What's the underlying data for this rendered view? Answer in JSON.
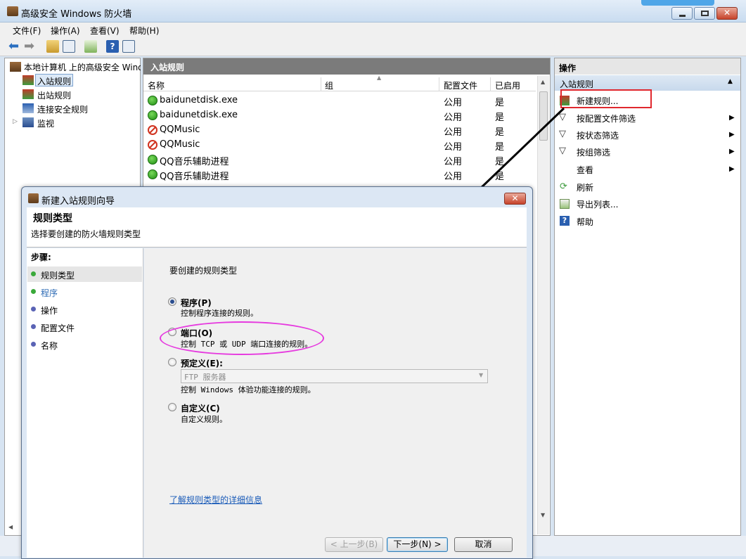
{
  "window": {
    "title": "高级安全 Windows 防火墙"
  },
  "menu": [
    "文件(F)",
    "操作(A)",
    "查看(V)",
    "帮助(H)"
  ],
  "tree": {
    "root": "本地计算机 上的高级安全 Wind",
    "items": [
      "入站规则",
      "出站规则",
      "连接安全规则",
      "监视"
    ]
  },
  "center": {
    "header": "入站规则",
    "columns": [
      "名称",
      "组",
      "配置文件",
      "已启用"
    ],
    "rows": [
      {
        "status": "allow",
        "name": "baidunetdisk.exe",
        "group": "",
        "profile": "公用",
        "enabled": "是"
      },
      {
        "status": "allow",
        "name": "baidunetdisk.exe",
        "group": "",
        "profile": "公用",
        "enabled": "是"
      },
      {
        "status": "block",
        "name": "QQMusic",
        "group": "",
        "profile": "公用",
        "enabled": "是"
      },
      {
        "status": "block",
        "name": "QQMusic",
        "group": "",
        "profile": "公用",
        "enabled": "是"
      },
      {
        "status": "allow",
        "name": "QQ音乐辅助进程",
        "group": "",
        "profile": "公用",
        "enabled": "是"
      },
      {
        "status": "allow",
        "name": "QQ音乐辅助进程",
        "group": "",
        "profile": "公用",
        "enabled": "是"
      }
    ]
  },
  "actions": {
    "header": "操作",
    "section": "入站规则",
    "items": [
      {
        "label": "新建规则...",
        "icon": "new-rule-icon",
        "submenu": false
      },
      {
        "label": "按配置文件筛选",
        "icon": "filter-icon",
        "submenu": true
      },
      {
        "label": "按状态筛选",
        "icon": "filter-icon",
        "submenu": true
      },
      {
        "label": "按组筛选",
        "icon": "filter-icon",
        "submenu": true
      },
      {
        "label": "查看",
        "icon": "",
        "submenu": true
      },
      {
        "label": "刷新",
        "icon": "refresh-icon",
        "submenu": false
      },
      {
        "label": "导出列表...",
        "icon": "export-icon",
        "submenu": false
      },
      {
        "label": "帮助",
        "icon": "help-icon",
        "submenu": false
      }
    ]
  },
  "dialog": {
    "title": "新建入站规则向导",
    "heading": "规则类型",
    "subheading": "选择要创建的防火墙规则类型",
    "steps_label": "步骤:",
    "steps": [
      "规则类型",
      "程序",
      "操作",
      "配置文件",
      "名称"
    ],
    "prompt": "要创建的规则类型",
    "options": [
      {
        "label": "程序(P)",
        "desc": "控制程序连接的规则。",
        "checked": true
      },
      {
        "label": "端口(O)",
        "desc": "控制 TCP 或 UDP 端口连接的规则。",
        "checked": false
      },
      {
        "label": "预定义(E):",
        "desc": "控制 Windows 体验功能连接的规则。",
        "checked": false
      },
      {
        "label": "自定义(C)",
        "desc": "自定义规则。",
        "checked": false
      }
    ],
    "predefined_value": "FTP 服务器",
    "link": "了解规则类型的详细信息",
    "buttons": {
      "back": "< 上一步(B)",
      "next": "下一步(N) >",
      "cancel": "取消"
    }
  },
  "colors": {
    "highlight_box": "#e0282e",
    "ellipse": "#e63adf",
    "arrow": "#000000",
    "step_active": "#3aa93a",
    "step_inactive": "#5a63b5"
  }
}
